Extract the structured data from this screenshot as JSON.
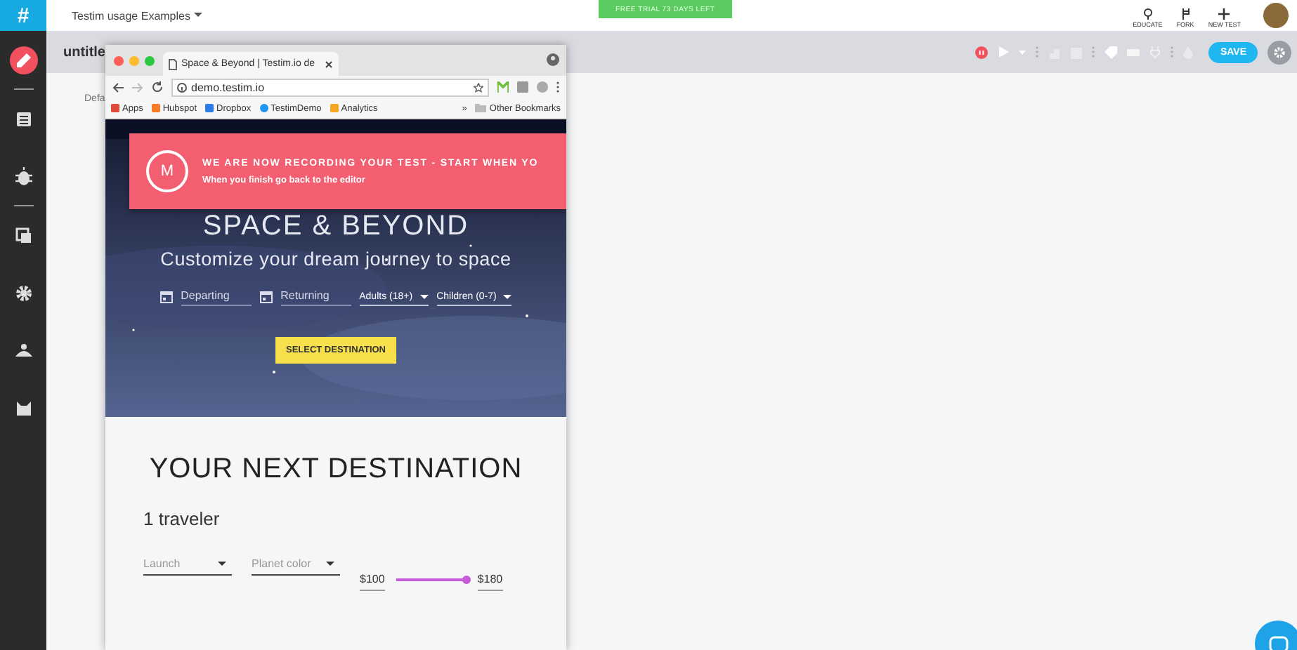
{
  "app": {
    "project": "Testim usage Examples",
    "trial_badge": "FREE TRIAL 73 DAYS LEFT",
    "top_actions": [
      {
        "label": "EDUCATE"
      },
      {
        "label": "FORK"
      },
      {
        "label": "NEW TEST"
      }
    ]
  },
  "sidebar": {
    "logo": "#",
    "items": [
      {
        "selected": true
      },
      {
        "selected": false
      },
      {
        "selected": false
      },
      {
        "selected": false
      },
      {
        "selected": false
      },
      {
        "selected": false
      },
      {
        "selected": false
      }
    ]
  },
  "test": {
    "title": "untitle",
    "panel_label": "Defa",
    "recording": true,
    "save": "SAVE"
  },
  "browser": {
    "tab_title": "Space & Beyond | Testim.io de",
    "url": "demo.testim.io",
    "bookmarks": [
      "Apps",
      "Hubspot",
      "Dropbox",
      "TestimDemo",
      "Analytics"
    ],
    "overflow": "»",
    "other_bookmarks": "Other Bookmarks"
  },
  "recording_banner": {
    "badge": "M",
    "title": "WE ARE NOW RECORDING YOUR TEST - START WHEN YO",
    "subtitle": "When you finish go back to the editor"
  },
  "site": {
    "hero_title": "SPACE & BEYOND",
    "hero_subtitle": "Customize your dream journey to space",
    "date_fields": [
      {
        "placeholder": "Departing"
      },
      {
        "placeholder": "Returning"
      }
    ],
    "selects": [
      "Adults (18+)",
      "Children (0-7)"
    ],
    "cta": "SELECT DESTINATION",
    "section_title": "YOUR NEXT DESTINATION",
    "travelers": "1 traveler",
    "filters": [
      {
        "placeholder": "Launch"
      },
      {
        "placeholder": "Planet color"
      }
    ],
    "price": {
      "min": "$100",
      "max": "$180",
      "level": 1
    }
  }
}
